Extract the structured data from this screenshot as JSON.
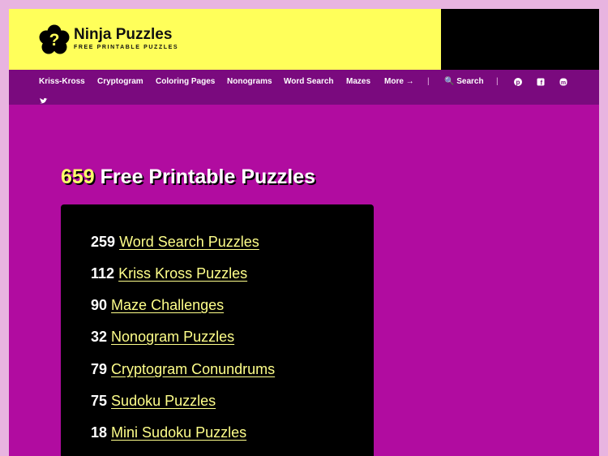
{
  "site": {
    "title": "Ninja Puzzles",
    "tagline": "FREE PRINTABLE PUZZLES"
  },
  "nav": {
    "items": [
      "Kriss-Kross",
      "Cryptogram",
      "Coloring Pages",
      "Nonograms",
      "Word Search",
      "Mazes",
      "More →"
    ],
    "separator": "|",
    "search_label": "🔍 Search",
    "social_icons": [
      "pinterest-icon",
      "facebook-icon",
      "mastodon-icon",
      "twitter-icon"
    ]
  },
  "main": {
    "heading_count": "659",
    "heading_text": " Free Printable Puzzles",
    "categories": [
      {
        "count": "259",
        "label": "Word Search Puzzles"
      },
      {
        "count": "112",
        "label": "Kriss Kross Puzzles"
      },
      {
        "count": "90",
        "label": "Maze Challenges"
      },
      {
        "count": "32",
        "label": "Nonogram Puzzles"
      },
      {
        "count": "79",
        "label": "Cryptogram Conundrums"
      },
      {
        "count": "75",
        "label": "Sudoku Puzzles"
      },
      {
        "count": "18",
        "label": "Mini Sudoku Puzzles"
      }
    ]
  },
  "colors": {
    "page_bg": "#e8b4e0",
    "brand_yellow": "#ffff5a",
    "main_purple": "#b10ca0",
    "nav_purple": "#7a0a7e",
    "link_yellow": "#ffff8a"
  }
}
